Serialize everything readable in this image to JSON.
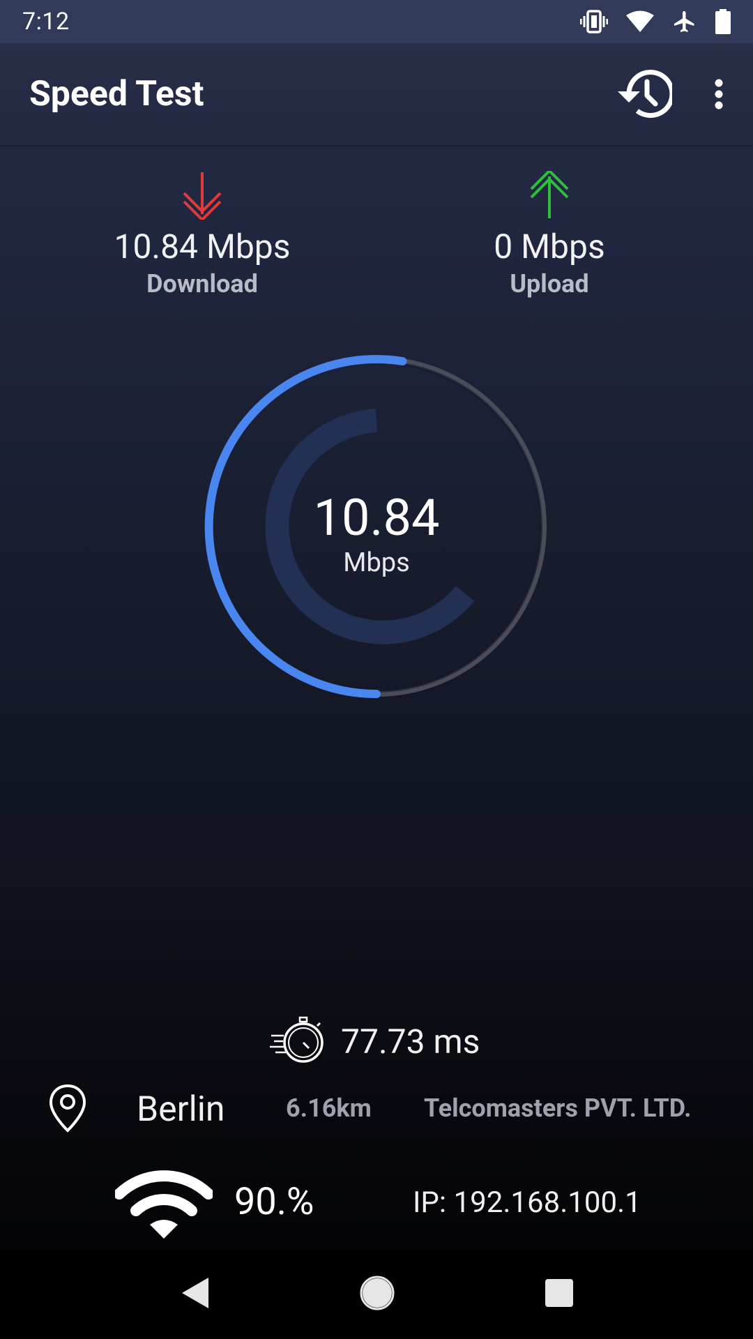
{
  "status_bar": {
    "time": "7:12",
    "icons": [
      "vibrate-icon",
      "wifi-icon",
      "airplane-icon",
      "battery-icon"
    ]
  },
  "app_bar": {
    "title": "Speed Test",
    "actions": [
      "history-icon",
      "more-vert-icon"
    ]
  },
  "download": {
    "value": "10.84 Mbps",
    "label": "Download",
    "arrow_color": "#e23a3a"
  },
  "upload": {
    "value": "0 Mbps",
    "label": "Upload",
    "arrow_color": "#2dbf3a"
  },
  "gauge": {
    "value": "10.84",
    "unit": "Mbps",
    "accent_color": "#4a86f0",
    "track_color": "#4a4c58",
    "progress_fraction": 0.67
  },
  "ping": {
    "value": "77.73 ms",
    "icon": "stopwatch-icon"
  },
  "location": {
    "city": "Berlin",
    "distance": "6.16km",
    "isp": "Telcomasters PVT. LTD."
  },
  "network": {
    "signal": "90.%",
    "ip": "IP: 192.168.100.1"
  },
  "nav_bar": {
    "buttons": [
      "back-icon",
      "home-icon",
      "recents-icon"
    ]
  }
}
